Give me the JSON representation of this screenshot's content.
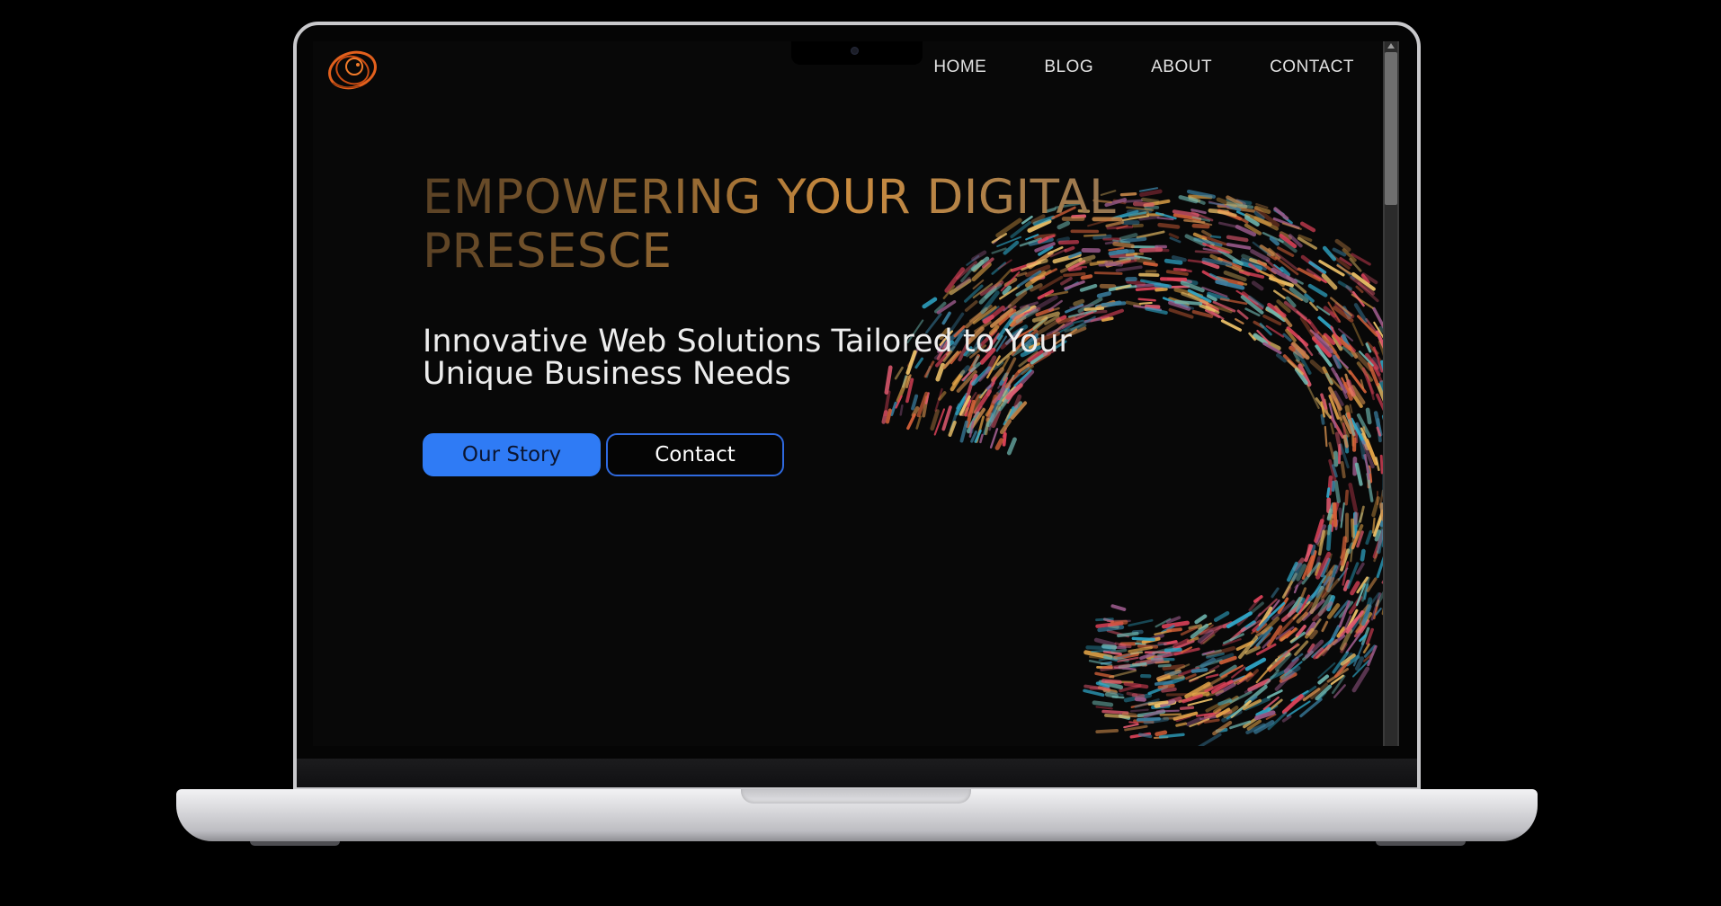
{
  "nav": {
    "items": [
      {
        "label": "HOME"
      },
      {
        "label": "BLOG"
      },
      {
        "label": "ABOUT"
      },
      {
        "label": "CONTACT"
      }
    ]
  },
  "hero": {
    "headline_line1": "EMPOWERING YOUR DIGITAL",
    "headline_line2": "PRESESCE",
    "subhead_line1": "Innovative Web Solutions Tailored to Your",
    "subhead_line2": "Unique Business Needs"
  },
  "buttons": {
    "primary_label": "Our Story",
    "secondary_label": "Contact"
  },
  "colors": {
    "page_background": "#000000",
    "screen_background": "#080808",
    "primary_button": "#2f7bf5",
    "headline_gold": "#c98b3f",
    "laptop_silver": "#d8d8dc"
  },
  "icons": {
    "logo": "orbit-logo-icon",
    "scroll_up": "scroll-up-arrow-icon"
  }
}
